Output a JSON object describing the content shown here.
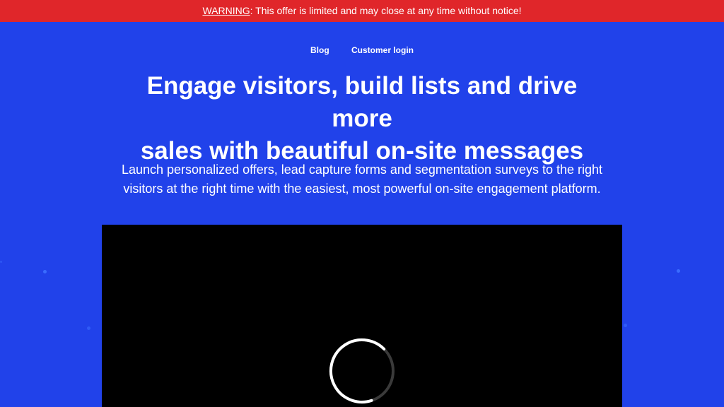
{
  "warning_bar": {
    "label": "WARNING",
    "message": ": This offer is limited and may close at any time without notice!"
  },
  "nav": {
    "items": [
      {
        "label": "Blog"
      },
      {
        "label": "Customer login"
      }
    ]
  },
  "hero": {
    "headline_line1": "Engage visitors, build lists and drive more",
    "headline_line2": "sales with beautiful on-site messages",
    "subhead_line1": "Launch personalized offers, lead capture forms and segmentation surveys to the right",
    "subhead_line2": "visitors at the right time with the easiest, most powerful on-site engagement platform."
  },
  "video": {
    "state": "loading"
  },
  "colors": {
    "background": "#2142ea",
    "warning_bar": "#e0262a",
    "video_background": "#000000",
    "text": "#ffffff"
  }
}
